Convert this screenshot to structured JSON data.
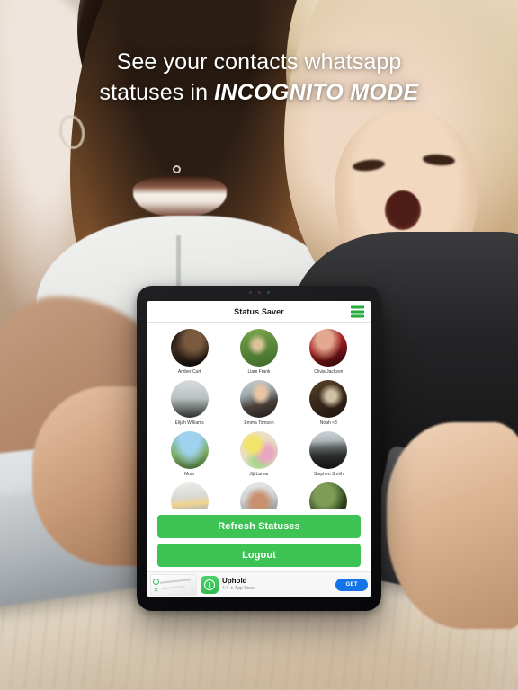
{
  "headline": {
    "line1": "See your contacts whatsapp",
    "line2_plain": "statuses in ",
    "line2_bold": "INCOGNITO MODE"
  },
  "colors": {
    "brand_green": "#3dc254",
    "menu_green": "#2fc249",
    "ad_button_blue": "#1473e6",
    "headline_text": "#ffffff",
    "screen_background": "#ffffff"
  },
  "app": {
    "title": "Status Saver",
    "menu_icon": "hamburger-menu-icon",
    "contacts": [
      {
        "name": "Amber Curt"
      },
      {
        "name": "Liam Frank"
      },
      {
        "name": "Olivia Jackson"
      },
      {
        "name": "Elijah Williams"
      },
      {
        "name": "Emma Tomson"
      },
      {
        "name": "Noah <3"
      },
      {
        "name": "Mom"
      },
      {
        "name": "Jiji Lamar"
      },
      {
        "name": "Stephen Smith"
      },
      {
        "name": ""
      },
      {
        "name": ""
      },
      {
        "name": ""
      }
    ],
    "buttons": {
      "refresh": "Refresh Statuses",
      "logout": "Logout"
    },
    "ad": {
      "title": "Uphold",
      "subtitle": "4.7 ★ App Store",
      "cta": "GET",
      "icon": "uphold-app-icon",
      "thumb": "chart-screenshot-thumbnail"
    }
  }
}
